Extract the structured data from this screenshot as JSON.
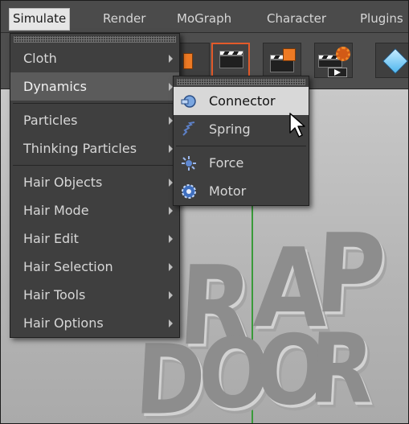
{
  "menubar": {
    "items": [
      {
        "label": "Simulate",
        "active": true
      },
      {
        "label": "Render"
      },
      {
        "label": "MoGraph"
      },
      {
        "label": "Character"
      },
      {
        "label": "Plugins"
      }
    ]
  },
  "toolbar": {
    "buttons": [
      {
        "icon": "object-icon"
      },
      {
        "icon": "render-view-icon"
      },
      {
        "icon": "render-picture-icon"
      },
      {
        "icon": "render-settings-icon"
      },
      {
        "icon": "cube-icon"
      }
    ]
  },
  "simulate_menu": {
    "items": [
      {
        "label": "Cloth",
        "has_submenu": true
      },
      {
        "label": "Dynamics",
        "has_submenu": true,
        "selected": true
      },
      {
        "label": "Particles",
        "has_submenu": true
      },
      {
        "label": "Thinking Particles",
        "has_submenu": true
      },
      {
        "label": "Hair Objects",
        "has_submenu": true
      },
      {
        "label": "Hair Mode",
        "has_submenu": true
      },
      {
        "label": "Hair Edit",
        "has_submenu": true
      },
      {
        "label": "Hair Selection",
        "has_submenu": true
      },
      {
        "label": "Hair Tools",
        "has_submenu": true
      },
      {
        "label": "Hair Options",
        "has_submenu": true
      }
    ]
  },
  "dynamics_submenu": {
    "items": [
      {
        "label": "Connector",
        "icon": "connector-icon",
        "hover": true
      },
      {
        "label": "Spring",
        "icon": "spring-icon"
      },
      {
        "label": "Force",
        "icon": "force-icon"
      },
      {
        "label": "Motor",
        "icon": "motor-icon"
      }
    ]
  },
  "viewport": {
    "letters": [
      "R",
      "A",
      "P",
      "D",
      "O",
      "O",
      "R"
    ]
  },
  "colors": {
    "menu_bg": "#3f3f3f",
    "menu_selected": "#5b5b5b",
    "hover_item": "#d8d8d8",
    "accent_orange": "#e25a2a",
    "axis_green": "#3a9a3a"
  }
}
